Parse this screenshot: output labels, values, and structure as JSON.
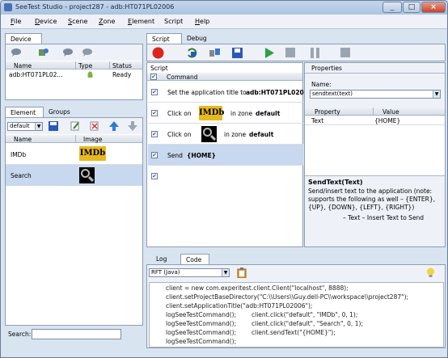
{
  "window": {
    "title": "SeeTest Studio - project287 - adb:HT071PL02006",
    "minimize": "_",
    "maximize": "□",
    "close": "×"
  },
  "menu": {
    "items": [
      {
        "label": "File",
        "underline": "F",
        "rest": "ile"
      },
      {
        "label": "Device",
        "underline": "D",
        "rest": "evice"
      },
      {
        "label": "Scene",
        "underline": "S",
        "rest": "cene"
      },
      {
        "label": "Zone",
        "underline": "Z",
        "rest": "one"
      },
      {
        "label": "Element",
        "underline": "E",
        "rest": "lement"
      },
      {
        "label": "Script",
        "underline": "",
        "rest": "Script"
      },
      {
        "label": "Help",
        "underline": "H",
        "rest": "elp"
      }
    ]
  },
  "device_panel": {
    "tab": "Device",
    "columns": [
      "Name",
      "Type",
      "Status"
    ],
    "rows": [
      {
        "name": "adb:HT071PL02...",
        "type_icon": "android-icon",
        "status": "Ready"
      }
    ]
  },
  "element_panel": {
    "tabs": [
      "Element",
      "Groups"
    ],
    "zone_select": "default",
    "columns": [
      "Name",
      "Image"
    ],
    "rows": [
      {
        "name": "IMDb",
        "image": "IMDb"
      },
      {
        "name": "Search",
        "image": "search-lens"
      }
    ],
    "search_label": "Search:",
    "search_value": ""
  },
  "script_panel": {
    "tabs": [
      "Script",
      "Debug"
    ],
    "header": "Script",
    "command_col": "Command",
    "commands": [
      {
        "checked": true,
        "text": "Set the application title to",
        "bold": "adb:HT071PL020"
      },
      {
        "checked": true,
        "text": "Click on",
        "image": "IMDb",
        "mid": "in zone",
        "bold": "default"
      },
      {
        "checked": true,
        "text": "Click on",
        "image": "search-lens",
        "mid": "in zone",
        "bold": "default"
      },
      {
        "checked": true,
        "text": "Send",
        "bold": "{HOME}"
      },
      {
        "checked": true,
        "text": "",
        "bold": ""
      }
    ]
  },
  "properties_panel": {
    "title": "Properties",
    "name_label": "Name:",
    "name_value": "sendtext(text)",
    "columns": [
      "Property",
      "Value"
    ],
    "rows": [
      {
        "property": "Text",
        "value": "{HOME}"
      }
    ],
    "help_title": "SendText(Text)",
    "help_lines": [
      "Send/insert text to the application (note:",
      "supports the following as well – {ENTER},",
      "{UP}, {DOWN}, {LEFT}, {RIGHT})",
      "– Text – Insert Text to Send"
    ]
  },
  "code_panel": {
    "tabs": [
      "Log",
      "Code"
    ],
    "language": "RFT (Java)",
    "lines": [
      {
        "a": "client = new com.experitest.client.Client(\"localhost\", 8888);",
        "b": ""
      },
      {
        "a": "client.setProjectBaseDirectory(\"C:\\\\Users\\\\Guy.dell-PC\\\\workspace\\\\project287\");",
        "b": ""
      },
      {
        "a": "client.setApplicationTitle(\"adb:HT071PL02006\");",
        "b": ""
      },
      {
        "a": "logSeeTestCommand();",
        "b": "client.click(\"default\", \"IMDb\", 0, 1);"
      },
      {
        "a": "logSeeTestCommand();",
        "b": "client.click(\"default\", \"Search\", 0, 1);"
      },
      {
        "a": "logSeeTestCommand();",
        "b": "client.sendText(\"{HOME}\");"
      },
      {
        "a": "logSeeTestCommand();",
        "b": ""
      }
    ]
  },
  "colors": {
    "record": "#d9261c",
    "play": "#2ea043",
    "save": "#2b59b8",
    "selection": "#c8d8ee"
  }
}
